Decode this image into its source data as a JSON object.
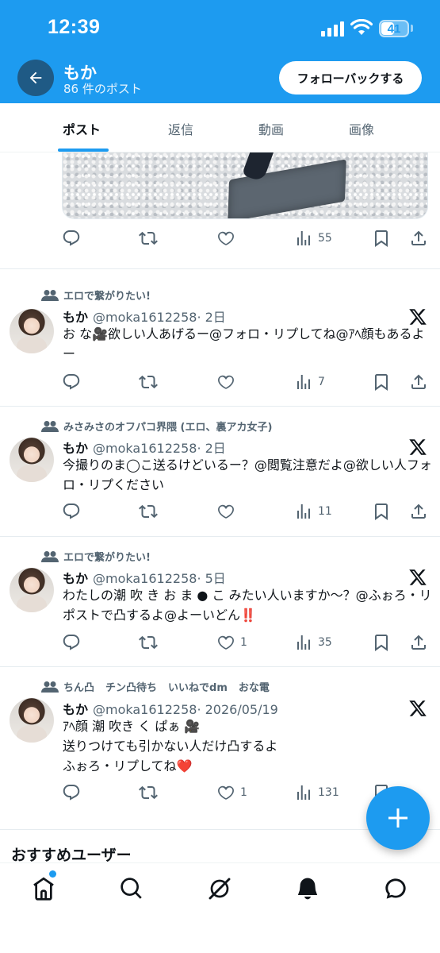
{
  "status_bar": {
    "time": "12:39",
    "battery": "41"
  },
  "header": {
    "name": "もか",
    "post_count": "86 件のポスト",
    "follow_back_label": "フォローバックする"
  },
  "tabs": [
    {
      "label": "ポスト",
      "active": true
    },
    {
      "label": "返信",
      "active": false
    },
    {
      "label": "動画",
      "active": false
    },
    {
      "label": "画像",
      "active": false
    }
  ],
  "first_post_actions": {
    "views": "55"
  },
  "tweets": [
    {
      "context": [
        "エロで繋がりたい!"
      ],
      "name": "もか",
      "handle": "@moka1612258",
      "date": "· 2日",
      "text": "お な🎥欲しい人あげるー@フォロ・リプしてね@ｱﾍ顔もあるよー",
      "replies": "",
      "retweets": "",
      "likes": "",
      "views": "7"
    },
    {
      "context": [
        "みさみさのオフパコ界隈 (エロ、裏アカ女子)"
      ],
      "name": "もか",
      "handle": "@moka1612258",
      "date": "· 2日",
      "text": "今撮りのま◯こ送るけどいるー？@閲覧注意だよ@欲しい人フォロ・リプください",
      "replies": "",
      "retweets": "",
      "likes": "",
      "views": "11"
    },
    {
      "context": [
        "エロで繋がりたい!"
      ],
      "name": "もか",
      "handle": "@moka1612258",
      "date": "· 5日",
      "text": "わたしの潮 吹 き お ま ● こ みたい人いますか〜？@ふぉろ・リポストで凸するよ@よーいどん‼️",
      "replies": "",
      "retweets": "",
      "likes": "1",
      "views": "35"
    },
    {
      "context": [
        "ちん凸",
        "チン凸待ち",
        "いいねでdm",
        "おな電"
      ],
      "name": "もか",
      "handle": "@moka1612258",
      "date": "· 2026/05/19",
      "text": "ｱﾍ顔 潮 吹き く ぱぁ 🎥\n送りつけても引かない人だけ凸するよ\nふぉろ・リプしてね❤️",
      "replies": "",
      "retweets": "",
      "likes": "1",
      "views": "131"
    }
  ],
  "recommended_title": "おすすめユーザー",
  "colors": {
    "accent": "#1d9bf0",
    "text": "#0f1419",
    "muted": "#536471"
  },
  "icons": [
    "back-arrow-icon",
    "reply-icon",
    "retweet-icon",
    "like-icon",
    "views-icon",
    "bookmark-icon",
    "share-icon",
    "x-logo-icon",
    "community-icon",
    "home-icon",
    "search-icon",
    "grok-icon",
    "bell-icon",
    "messages-icon",
    "compose-plus-icon"
  ]
}
